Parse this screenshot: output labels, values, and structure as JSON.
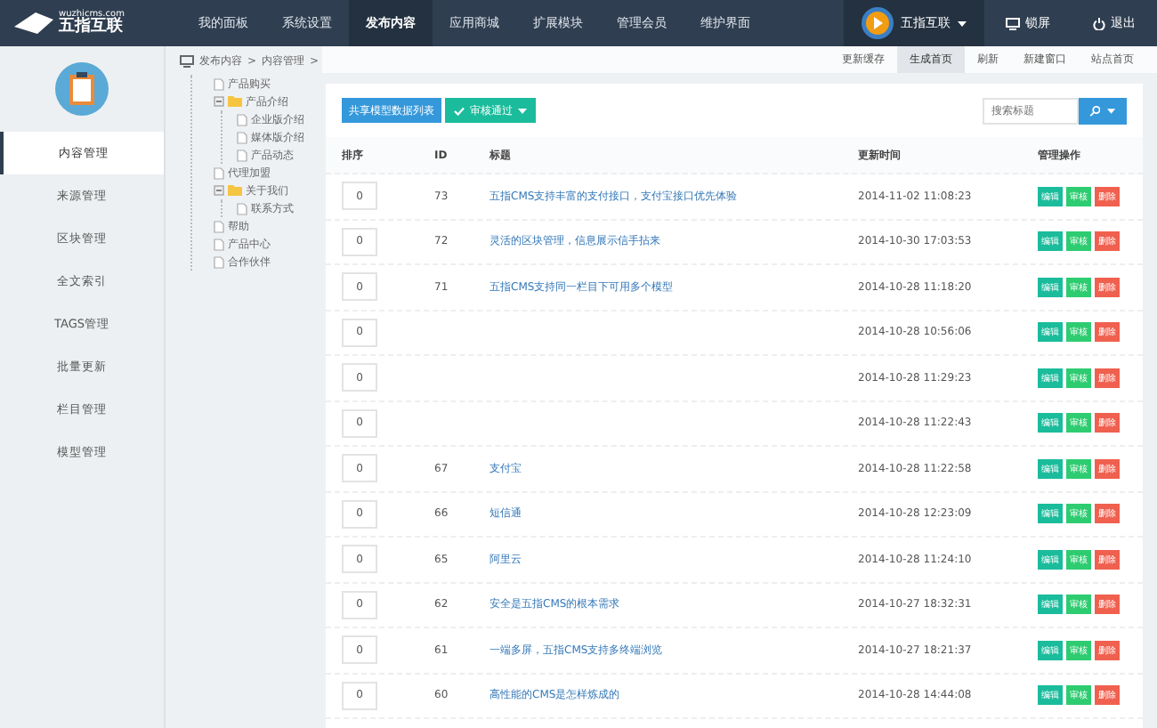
{
  "logo": {
    "domain": "wuzhicms.com",
    "name": "五指互联"
  },
  "nav": [
    {
      "label": "我的面板",
      "selected": false
    },
    {
      "label": "系统设置",
      "selected": false
    },
    {
      "label": "发布内容",
      "selected": true
    },
    {
      "label": "应用商城",
      "selected": false
    },
    {
      "label": "扩展模块",
      "selected": false
    },
    {
      "label": "管理会员",
      "selected": false
    },
    {
      "label": "维护界面",
      "selected": false
    }
  ],
  "user": {
    "name": "五指互联"
  },
  "top_actions": [
    {
      "kind": "lock",
      "label": "锁屏"
    },
    {
      "kind": "logout",
      "label": "退出"
    }
  ],
  "sidebar": {
    "items": [
      {
        "label": "内容管理",
        "selected": true
      },
      {
        "label": "来源管理",
        "selected": false
      },
      {
        "label": "区块管理",
        "selected": false
      },
      {
        "label": "全文索引",
        "selected": false
      },
      {
        "label": "TAGS管理",
        "selected": false
      },
      {
        "label": "批量更新",
        "selected": false
      },
      {
        "label": "栏目管理",
        "selected": false
      },
      {
        "label": "模型管理",
        "selected": false
      }
    ]
  },
  "breadcrumb": [
    {
      "label": "发布内容",
      "separator": ">"
    },
    {
      "label": "内容管理",
      "separator": ">"
    }
  ],
  "tree": [
    {
      "label": "产品购买",
      "kind": "page"
    },
    {
      "label": "产品介绍",
      "kind": "folder",
      "expanded": true,
      "children": [
        {
          "label": "企业版介绍",
          "kind": "page"
        },
        {
          "label": "媒体版介绍",
          "kind": "page"
        },
        {
          "label": "产品动态",
          "kind": "page"
        }
      ]
    },
    {
      "label": "代理加盟",
      "kind": "page"
    },
    {
      "label": "关于我们",
      "kind": "folder",
      "expanded": true,
      "children": [
        {
          "label": "联系方式",
          "kind": "page"
        }
      ]
    },
    {
      "label": "帮助",
      "kind": "page"
    },
    {
      "label": "产品中心",
      "kind": "page"
    },
    {
      "label": "合作伙伴",
      "kind": "page"
    }
  ],
  "page_tabs": [
    {
      "label": "更新缓存",
      "selected": false
    },
    {
      "label": "生成首页",
      "selected": true
    },
    {
      "label": "刷新",
      "selected": false
    },
    {
      "label": "新建窗口",
      "selected": false
    },
    {
      "label": "站点首页",
      "selected": false
    }
  ],
  "toolbar": {
    "list_button": "共享模型数据列表",
    "approve_button": "审核通过",
    "search": {
      "placeholder": "搜索标题"
    }
  },
  "table": {
    "columns": [
      "排序",
      "ID",
      "标题",
      "更新时间",
      "管理操作"
    ],
    "rows": [
      {
        "order": "0",
        "id": "73",
        "title": "五指CMS支持丰富的支付接口，支付宝接口优先体验",
        "time": "2014-11-02 11:08:23",
        "actions": [
          "编辑",
          "审核",
          "删除"
        ]
      },
      {
        "order": "0",
        "id": "72",
        "title": "灵活的区块管理，信息展示信手拈来",
        "time": "2014-10-30 17:03:53",
        "actions": [
          "编辑",
          "审核",
          "删除"
        ]
      },
      {
        "order": "0",
        "id": "71",
        "title": "五指CMS支持同一栏目下可用多个模型",
        "time": "2014-10-28 11:18:20",
        "actions": [
          "编辑",
          "审核",
          "删除"
        ]
      },
      {
        "order": "0",
        "time": "2014-10-28 10:56:06",
        "actions": [
          "编辑",
          "审核",
          "删除"
        ]
      },
      {
        "order": "0",
        "time": "2014-10-28 11:29:23",
        "actions": [
          "编辑",
          "审核",
          "删除"
        ]
      },
      {
        "order": "0",
        "time": "2014-10-28 11:22:43",
        "actions": [
          "编辑",
          "审核",
          "删除"
        ]
      },
      {
        "order": "0",
        "id": "67",
        "title": "支付宝",
        "time": "2014-10-28 11:22:58",
        "actions": [
          "编辑",
          "审核",
          "删除"
        ]
      },
      {
        "order": "0",
        "id": "66",
        "title": "短信通",
        "time": "2014-10-28 12:23:09",
        "actions": [
          "编辑",
          "审核",
          "删除"
        ]
      },
      {
        "order": "0",
        "id": "65",
        "title": "阿里云",
        "time": "2014-10-28 11:24:10",
        "actions": [
          "编辑",
          "审核",
          "删除"
        ]
      },
      {
        "order": "0",
        "id": "62",
        "title": "安全是五指CMS的根本需求",
        "time": "2014-10-27 18:32:31",
        "actions": [
          "编辑",
          "审核",
          "删除"
        ]
      },
      {
        "order": "0",
        "id": "61",
        "title": "一端多屏，五指CMS支持多终端浏览",
        "time": "2014-10-27 18:21:37",
        "actions": [
          "编辑",
          "审核",
          "删除"
        ]
      },
      {
        "order": "0",
        "id": "60",
        "title": "高性能的CMS是怎样炼成的",
        "time": "2014-10-28 14:44:08",
        "actions": [
          "编辑",
          "审核",
          "删除"
        ]
      }
    ]
  }
}
